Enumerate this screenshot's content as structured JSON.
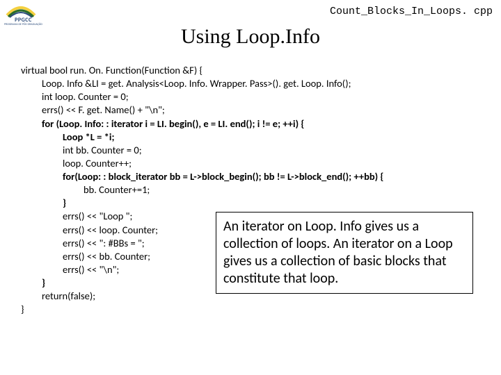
{
  "logo": {
    "text": "PPGCC",
    "sub": "PROGRAMA DE PÓS-GRADUAÇÃO"
  },
  "header": {
    "filename": "Count_Blocks_In_Loops. cpp",
    "title": "Using Loop.Info"
  },
  "code": {
    "l0": "virtual bool run. On. Function(Function &F) {",
    "l1": "Loop. Info &LI = get. Analysis<Loop. Info. Wrapper. Pass>(). get. Loop. Info();",
    "l2": "int loop. Counter = 0;",
    "l3": "errs() << F. get. Name() + \"\\n\";",
    "l4": "for (Loop. Info: : iterator i = LI. begin(), e = LI. end(); i != e; ++i) {",
    "l5": "Loop *L = *i;",
    "l6": "int bb. Counter = 0;",
    "l7": "loop. Counter++;",
    "l8": "for(Loop: : block_iterator bb = L->block_begin(); bb != L->block_end(); ++bb) {",
    "l9": "bb. Counter+=1;",
    "l10": "}",
    "l11": "errs() << \"Loop \";",
    "l12": "errs() << loop. Counter;",
    "l13": "errs() << \": #BBs = \";",
    "l14": "errs() << bb. Counter;",
    "l15": "errs() << \"\\n\";",
    "l16": "}",
    "l17": "return(false);",
    "l18": "}"
  },
  "callout": {
    "text": "An iterator on Loop. Info gives us a collection of loops. An iterator on a Loop gives us a collection of basic blocks that constitute that loop."
  }
}
